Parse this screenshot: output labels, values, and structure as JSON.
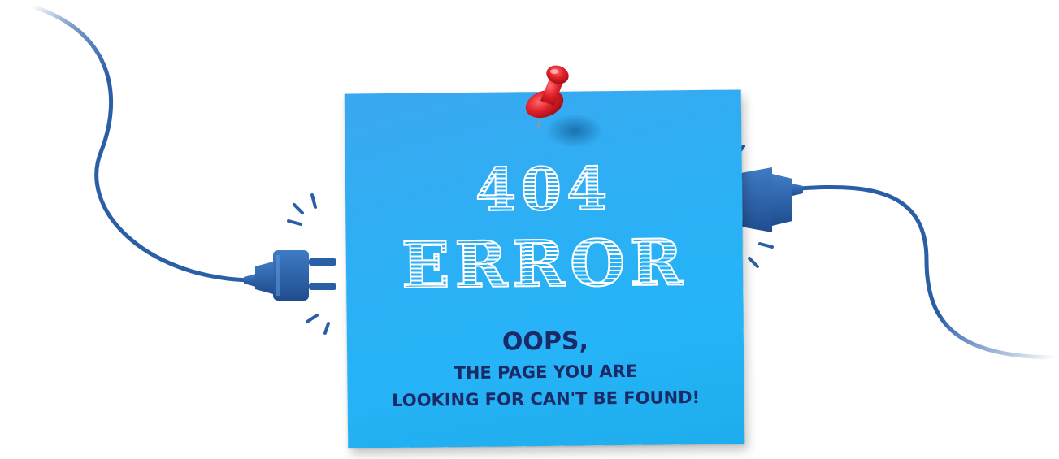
{
  "note": {
    "code": "404",
    "heading": "ERROR",
    "oops": "OOPS,",
    "line1": "THE PAGE YOU ARE",
    "line2": "LOOKING FOR CAN'T BE FOUND!"
  },
  "colors": {
    "background": "#ffffff",
    "note": "#2bb0f5",
    "text_dark": "#1a2a66",
    "cable": "#2a5fa8",
    "pin": "#e0202a"
  },
  "icons": {
    "left": "plug-icon",
    "right": "socket-icon",
    "pin": "pushpin-icon"
  }
}
